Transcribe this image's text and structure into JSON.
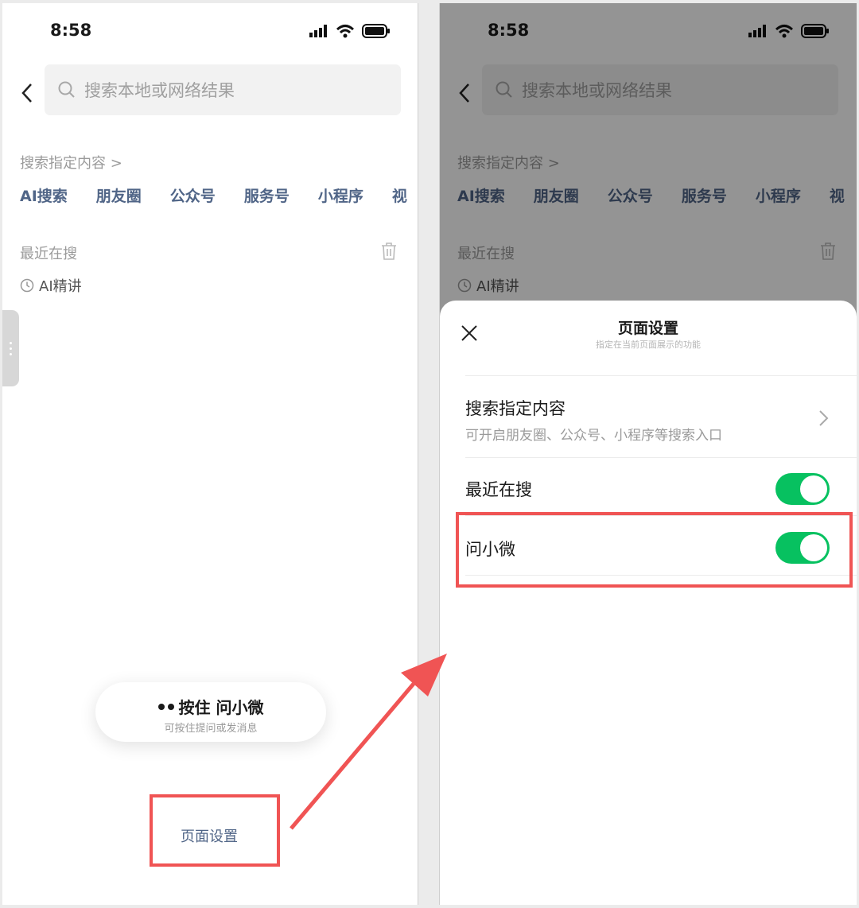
{
  "status": {
    "time": "8:58"
  },
  "search": {
    "placeholder": "搜索本地或网络结果"
  },
  "specified_content": {
    "label": "搜索指定内容 >",
    "categories": [
      "AI搜索",
      "朋友圈",
      "公众号",
      "服务号",
      "小程序",
      "视"
    ]
  },
  "recent": {
    "label": "最近在搜",
    "items": [
      "AI精讲"
    ]
  },
  "assistant_pill": {
    "title": "按住 问小微",
    "subtitle": "可按住提问或发消息"
  },
  "footer": {
    "page_settings_label": "页面设置"
  },
  "sheet": {
    "title": "页面设置",
    "subtitle": "指定在当前页面展示的功能",
    "rows": [
      {
        "title": "搜索指定内容",
        "subtitle": "可开启朋友圈、公众号、小程序等搜索入口"
      },
      {
        "title": "最近在搜",
        "enabled": true
      },
      {
        "title": "问小微",
        "enabled": true
      }
    ]
  },
  "colors": {
    "accent_link": "#506587",
    "toggle_on": "#07c160",
    "highlight": "#f05454"
  },
  "icons": [
    "back-icon",
    "search-icon",
    "trash-icon",
    "clock-icon",
    "close-icon",
    "chevron-right-icon",
    "signal-icon",
    "wifi-icon",
    "battery-icon"
  ]
}
